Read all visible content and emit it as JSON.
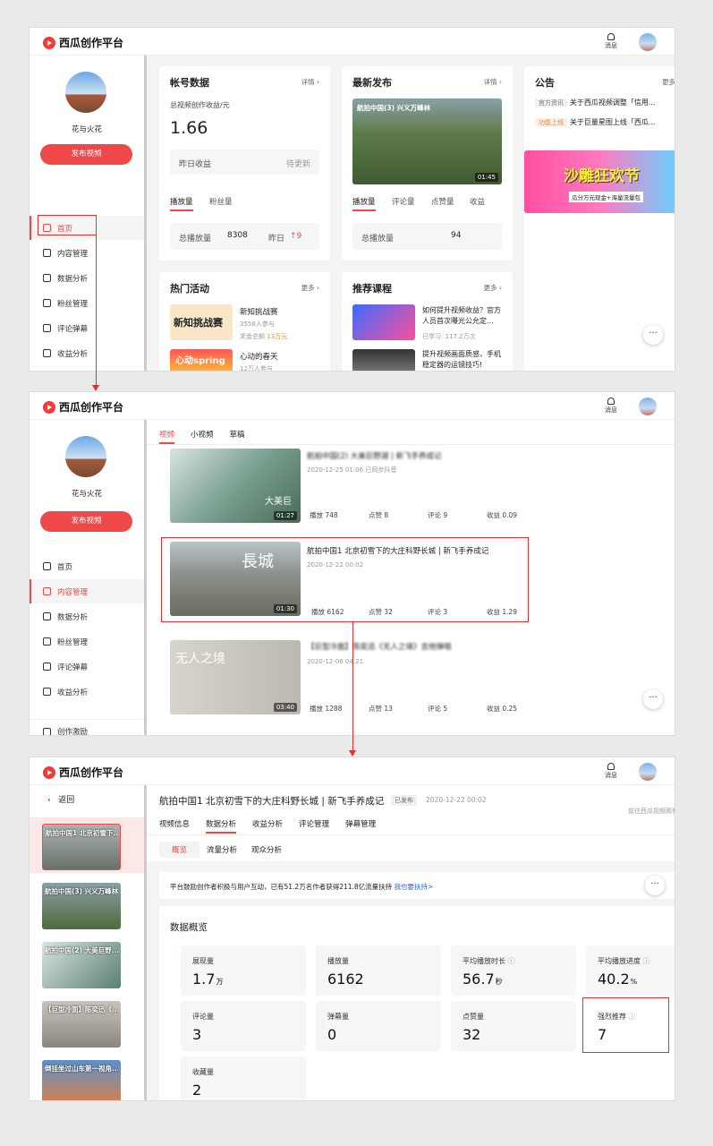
{
  "app": {
    "logo_text": "西瓜创作平台",
    "messages_label": "消息"
  },
  "user": {
    "name": "花与火花",
    "publish_label": "发布视频"
  },
  "nav": [
    "首页",
    "内容管理",
    "数据分析",
    "粉丝管理",
    "评论弹幕",
    "收益分析",
    "创作激励"
  ],
  "panel1": {
    "account": {
      "title": "帐号数据",
      "detail": "详情",
      "subtitle": "总视频创作收益/元",
      "value": "1.66",
      "yesterday_label": "昨日收益",
      "yesterday_value": "待更新",
      "tab1": "播放量",
      "tab2": "粉丝量",
      "total_label": "总播放量",
      "total_value": "8308",
      "day_label": "昨日",
      "day_value": "9"
    },
    "latest": {
      "title": "最新发布",
      "detail": "详情",
      "video_title": "航拍中国(3) 兴义万峰林",
      "duration": "01:45",
      "tabs": [
        "播放量",
        "评论量",
        "点赞量",
        "收益"
      ],
      "total_label": "总播放量",
      "total_value": "94"
    },
    "notice": {
      "title": "公告",
      "more": "更多",
      "items": [
        {
          "tag": "官方资讯",
          "text": "关于西瓜视频调整「信用..."
        },
        {
          "tag": "功能上线",
          "text": "关于巨量星图上线「西瓜..."
        }
      ],
      "banner_text": "沙雕狂欢节",
      "banner_sub": "瓜分万元现金+海量流量包"
    },
    "events": {
      "title": "热门活动",
      "more": "更多",
      "items": [
        {
          "name": "新知挑战赛",
          "sub": "3558人参与",
          "sub2": "奖金总额",
          "bonus": "13万元",
          "thumb_text": "新知挑战赛"
        },
        {
          "name": "心动的春天",
          "sub": "12万人参与",
          "thumb_text": "心动spring"
        }
      ]
    },
    "courses": {
      "title": "推荐课程",
      "more": "更多",
      "items": [
        {
          "title": "如何提升视频收益？官方人员首次曝光公允定...",
          "sub": "已学习: 117.2万次"
        },
        {
          "title": "提升视频画面质感，手机稳定器的运镜技巧!"
        }
      ]
    }
  },
  "panel2": {
    "tabs": [
      "视频",
      "小视频",
      "草稿"
    ],
    "videos": [
      {
        "title": "航拍中国(2) 大美巨野湖 | 新飞手养成记",
        "date": "2020-12-25 01:06",
        "status": "已同步抖音",
        "duration": "01:27",
        "thumb_text": "大美巨",
        "stats": {
          "play": "播放 748",
          "like": "点赞 8",
          "comment": "评论 9",
          "income": "收益 0.09"
        }
      },
      {
        "title": "航拍中国1 北京初雪下的大庄科野长城 | 新飞手养成记",
        "date": "2020-12-22 00:02",
        "duration": "01:30",
        "thumb_text": "長城",
        "stats": {
          "play": "播放 6162",
          "like": "点赞 32",
          "comment": "评论 3",
          "income": "收益 1.29"
        }
      },
      {
        "title": "【巨型冷面】陈奕迅《无人之境》吉他弹唱",
        "date": "2020-12-06 04:21",
        "duration": "03:40",
        "thumb_text": "无人之境",
        "stats": {
          "play": "播放 1288",
          "like": "点赞 13",
          "comment": "评论 5",
          "income": "收益 0.25"
        }
      }
    ]
  },
  "panel3": {
    "back": "返回",
    "title": "航拍中国1 北京初雪下的大庄科野长城 | 新飞手养成记",
    "badge": "已发布",
    "date": "2020-12-22 00:02",
    "goto": "前往西瓜视频观看",
    "tabs": [
      "视频信息",
      "数据分析",
      "收益分析",
      "评论管理",
      "弹幕管理"
    ],
    "subtabs": [
      "概览",
      "流量分析",
      "观众分析"
    ],
    "notice": "平台鼓励创作者积极与用户互动，已有51.2万名作者获得211.8亿流量扶持",
    "notice_link": "我也要扶持>",
    "overview_title": "数据概览",
    "metrics": [
      {
        "label": "展现量",
        "value": "1.7",
        "unit": "万"
      },
      {
        "label": "播放量",
        "value": "6162",
        "unit": ""
      },
      {
        "label": "平均播放时长",
        "value": "56.7",
        "unit": "秒"
      },
      {
        "label": "平均播放进度",
        "value": "40.2",
        "unit": "%"
      },
      {
        "label": "评论量",
        "value": "3",
        "unit": ""
      },
      {
        "label": "弹幕量",
        "value": "0",
        "unit": ""
      },
      {
        "label": "点赞量",
        "value": "32",
        "unit": ""
      },
      {
        "label": "强烈推荐",
        "value": "7",
        "unit": ""
      },
      {
        "label": "收藏量",
        "value": "2",
        "unit": ""
      }
    ],
    "list": [
      "航拍中国1 北京初雪下...",
      "航拍中国(3) 兴义万峰林",
      "航拍中国(2) 大美巨野...",
      "【巨型冷面】陈奕迅《...",
      "倒挂坐过山车第一视角..."
    ]
  }
}
